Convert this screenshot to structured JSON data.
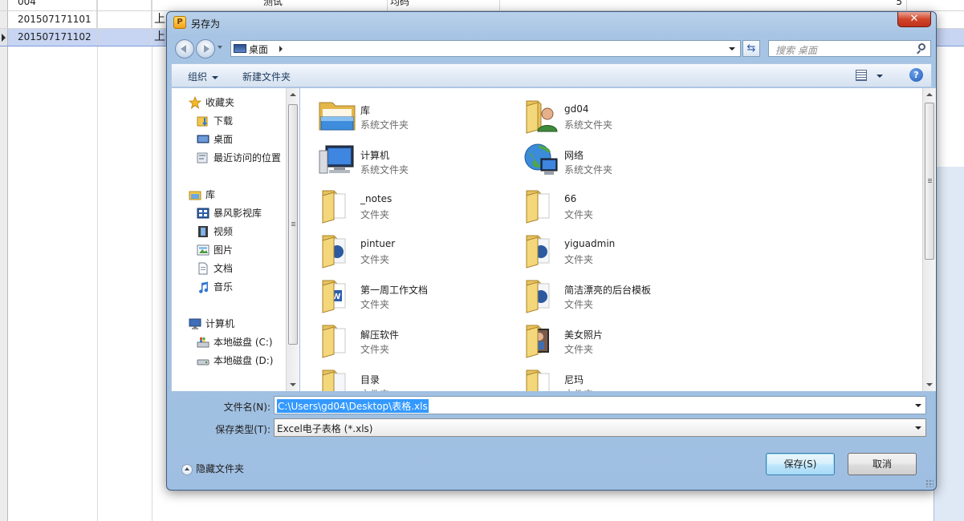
{
  "background": {
    "rows": [
      {
        "id": "004",
        "c2": "",
        "c3": "",
        "c4": "测试",
        "c5": "均码",
        "c6": "",
        "qty": "5",
        "selected": false
      },
      {
        "id": "201507171101",
        "c2": "上",
        "c3": "",
        "c4": "",
        "c5": "",
        "c6": "",
        "qty": "",
        "selected": false
      },
      {
        "id": "201507171102",
        "c2": "上",
        "c3": "",
        "c4": "",
        "c5": "",
        "c6": "",
        "qty": "",
        "selected": true
      }
    ]
  },
  "dialog": {
    "title": "另存为",
    "close_label": "✕",
    "address": {
      "location": "桌面"
    },
    "search_placeholder": "搜索 桌面",
    "toolbar": {
      "organize": "组织",
      "new_folder": "新建文件夹",
      "help": "?"
    },
    "nav": {
      "favorites": "收藏夹",
      "downloads": "下载",
      "desktop": "桌面",
      "recent": "最近访问的位置",
      "libraries": "库",
      "storm_video": "暴风影视库",
      "videos": "视频",
      "pictures": "图片",
      "documents": "文档",
      "music": "音乐",
      "computer": "计算机",
      "drive_c": "本地磁盘 (C:)",
      "drive_d": "本地磁盘 (D:)"
    },
    "files": [
      {
        "name": "库",
        "type": "系统文件夹",
        "icon": "library-folder-icon"
      },
      {
        "name": "gd04",
        "type": "系统文件夹",
        "icon": "user-folder-icon"
      },
      {
        "name": "计算机",
        "type": "系统文件夹",
        "icon": "computer-icon"
      },
      {
        "name": "网络",
        "type": "系统文件夹",
        "icon": "network-icon"
      },
      {
        "name": "_notes",
        "type": "文件夹",
        "icon": "folder-icon"
      },
      {
        "name": "66",
        "type": "文件夹",
        "icon": "folder-icon"
      },
      {
        "name": "pintuer",
        "type": "文件夹",
        "icon": "folder-icon"
      },
      {
        "name": "yiguadmin",
        "type": "文件夹",
        "icon": "folder-icon"
      },
      {
        "name": "第一周工作文档",
        "type": "文件夹",
        "icon": "word-folder-icon"
      },
      {
        "name": "简洁漂亮的后台模板",
        "type": "文件夹",
        "icon": "folder-icon"
      },
      {
        "name": "解压软件",
        "type": "文件夹",
        "icon": "folder-icon"
      },
      {
        "name": "美女照片",
        "type": "文件夹",
        "icon": "photo-folder-icon"
      },
      {
        "name": "目录",
        "type": "文件夹",
        "icon": "folder-icon"
      },
      {
        "name": "尼玛",
        "type": "文件夹",
        "icon": "folder-icon"
      }
    ],
    "form": {
      "filename_label": "文件名(N):",
      "filename_value": "C:\\Users\\gd04\\Desktop\\表格.xls",
      "filetype_label": "保存类型(T):",
      "filetype_value": "Excel电子表格 (*.xls)"
    },
    "hide_folders": "隐藏文件夹",
    "save_label": "保存(S)",
    "cancel_label": "取消"
  }
}
